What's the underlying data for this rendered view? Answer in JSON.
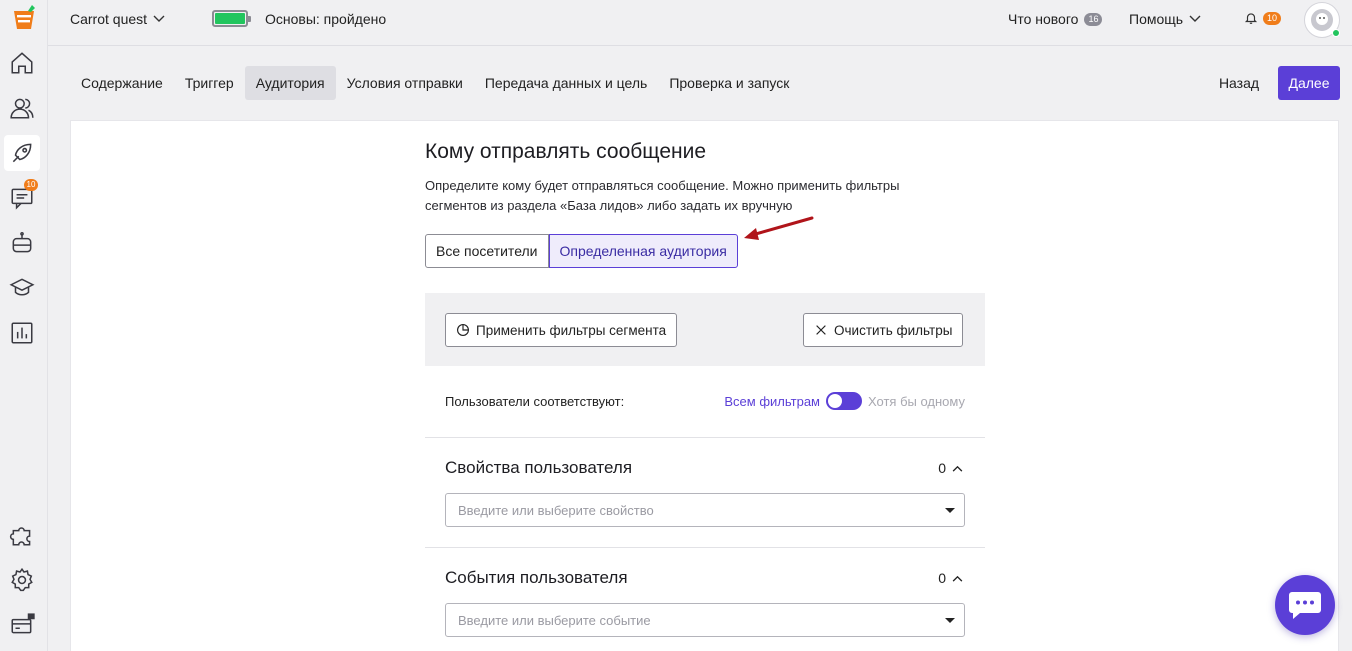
{
  "topbar": {
    "project_name": "Carrot quest",
    "onboarding_status": "Основы: пройдено",
    "whats_new_label": "Что нового",
    "whats_new_count": "16",
    "help_label": "Помощь",
    "notifications_count": "10"
  },
  "sidebar": {
    "chat_badge": "10"
  },
  "tabs": [
    {
      "label": "Содержание"
    },
    {
      "label": "Триггер"
    },
    {
      "label": "Аудитория"
    },
    {
      "label": "Условия отправки"
    },
    {
      "label": "Передача данных и цель"
    },
    {
      "label": "Проверка и запуск"
    }
  ],
  "actions": {
    "back_label": "Назад",
    "next_label": "Далее"
  },
  "audience": {
    "title": "Кому отправлять сообщение",
    "description": "Определите кому будет отправляться сообщение. Можно применить фильтры сегментов из раздела «База лидов» либо задать их вручную",
    "option_all": "Все посетители",
    "option_specific": "Определенная аудитория",
    "apply_segment_label": "Применить фильтры сегмента",
    "clear_filters_label": "Очистить фильтры",
    "match_label": "Пользователи соответствуют:",
    "match_all_label": "Всем фильтрам",
    "match_any_label": "Хотя бы одному"
  },
  "properties": {
    "title": "Свойства пользователя",
    "count": "0",
    "placeholder": "Введите или выберите свойство"
  },
  "events": {
    "title": "События пользователя",
    "count": "0",
    "placeholder": "Введите или выберите событие"
  },
  "colors": {
    "accent": "#5b3fd7",
    "badge": "#f07d1a",
    "arrow": "#b0141a"
  }
}
